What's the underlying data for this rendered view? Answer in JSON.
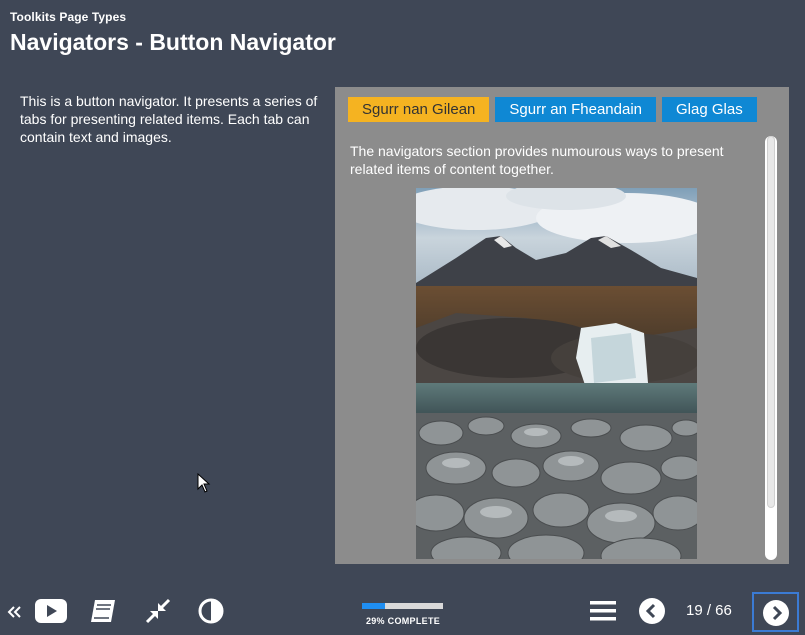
{
  "header": {
    "course_title": "Toolkits Page Types",
    "page_title": "Navigators - Button Navigator"
  },
  "intro": {
    "text": "This is a button navigator. It presents a series of tabs for presenting related items. Each tab can contain text and images."
  },
  "navigator": {
    "tabs": [
      {
        "label": "Sgurr nan Gilean",
        "active": true
      },
      {
        "label": "Sgurr an Fheandain",
        "active": false
      },
      {
        "label": "Glag Glas",
        "active": false
      }
    ],
    "content_text": "The navigators section provides numourous ways to present related items of content together.",
    "image_alt": "mountain waterfall photo"
  },
  "footer": {
    "progress_percent": 29,
    "progress_label": "29% COMPLETE",
    "page_current": "19",
    "page_total": "66",
    "page_display": "19 / 66",
    "icons": [
      "collapse-double-chevron-icon",
      "video-play-icon",
      "book-icon",
      "shrink-icon",
      "contrast-icon",
      "menu-icon",
      "prev-chevron-icon",
      "next-chevron-icon"
    ]
  },
  "colors": {
    "background": "#3f4756",
    "panel": "#8c8c8c",
    "tab_active": "#f5b321",
    "tab_inactive": "#0f88d4",
    "progress_fill": "#1f8ef1"
  }
}
